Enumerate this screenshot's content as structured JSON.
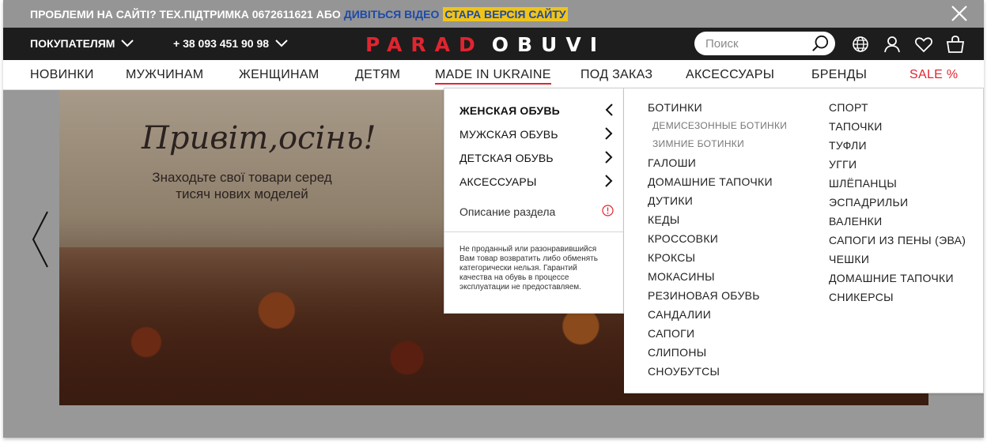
{
  "topbar": {
    "text": "ПРОБЛЕМИ НА САЙТІ? ТЕХ.ПІДТРИМКА 0672611621 АБО",
    "video_link": "ДИВІТЬСЯ ВІДЕО",
    "old_version": "СТАРА ВЕРСІЯ САЙТУ"
  },
  "header": {
    "buyers": "ПОКУПАТЕЛЯМ",
    "phone": "+ 38 093 451 90 98",
    "logo_red": "PARAD",
    "logo_white": "OBUVI",
    "search_placeholder": "Поиск"
  },
  "nav": {
    "items": [
      "НОВИНКИ",
      "МУЖЧИНАМ",
      "ЖЕНЩИНАМ",
      "ДЕТЯМ",
      "MADE IN UKRAINE",
      "ПОД ЗАКАЗ",
      "АКСЕССУАРЫ",
      "БРЕНДЫ",
      "SALE %"
    ]
  },
  "banner": {
    "title": "Привіт,осінь!",
    "subtitle": "Знаходьте свої товари серед тисяч нових моделей"
  },
  "menu": {
    "categories": [
      "ЖЕНСКАЯ ОБУВЬ",
      "МУЖСКАЯ ОБУВЬ",
      "ДЕТСКАЯ ОБУВЬ",
      "АКСЕССУАРЫ"
    ],
    "description": "Описание раздела",
    "note": "Не проданный или разонравившийся Вам товар возвратить либо обменять категорически нельзя. Гарантий качества на обувь в процессе эксплуатации не предоставляем.",
    "col1": [
      "БОТИНКИ",
      "ДЕМИСЕЗОННЫЕ БОТИНКИ",
      "ЗИМНИЕ БОТИНКИ",
      "ГАЛОШИ",
      "ДОМАШНИЕ ТАПОЧКИ",
      "ДУТИКИ",
      "КЕДЫ",
      "КРОССОВКИ",
      "КРОКСЫ",
      "МОКАСИНЫ",
      "РЕЗИНОВАЯ ОБУВЬ",
      "САНДАЛИИ",
      "САПОГИ",
      "СЛИПОНЫ",
      "СНОУБУТСЫ"
    ],
    "col2": [
      "СПОРТ",
      "ТАПОЧКИ",
      "ТУФЛИ",
      "УГГИ",
      "ШЛЁПАНЦЫ",
      "ЭСПАДРИЛЬИ",
      "ВАЛЕНКИ",
      "САПОГИ ИЗ ПЕНЫ (ЭВА)",
      "ЧЕШКИ",
      "ДОМАШНИЕ ТАПОЧКИ",
      "СНИКЕРСЫ"
    ]
  },
  "colors": {
    "accent_red": "#e02530",
    "header_dark": "#1d1d1d",
    "link_blue": "#1e4aa8",
    "highlight_yellow": "#f0c419"
  }
}
